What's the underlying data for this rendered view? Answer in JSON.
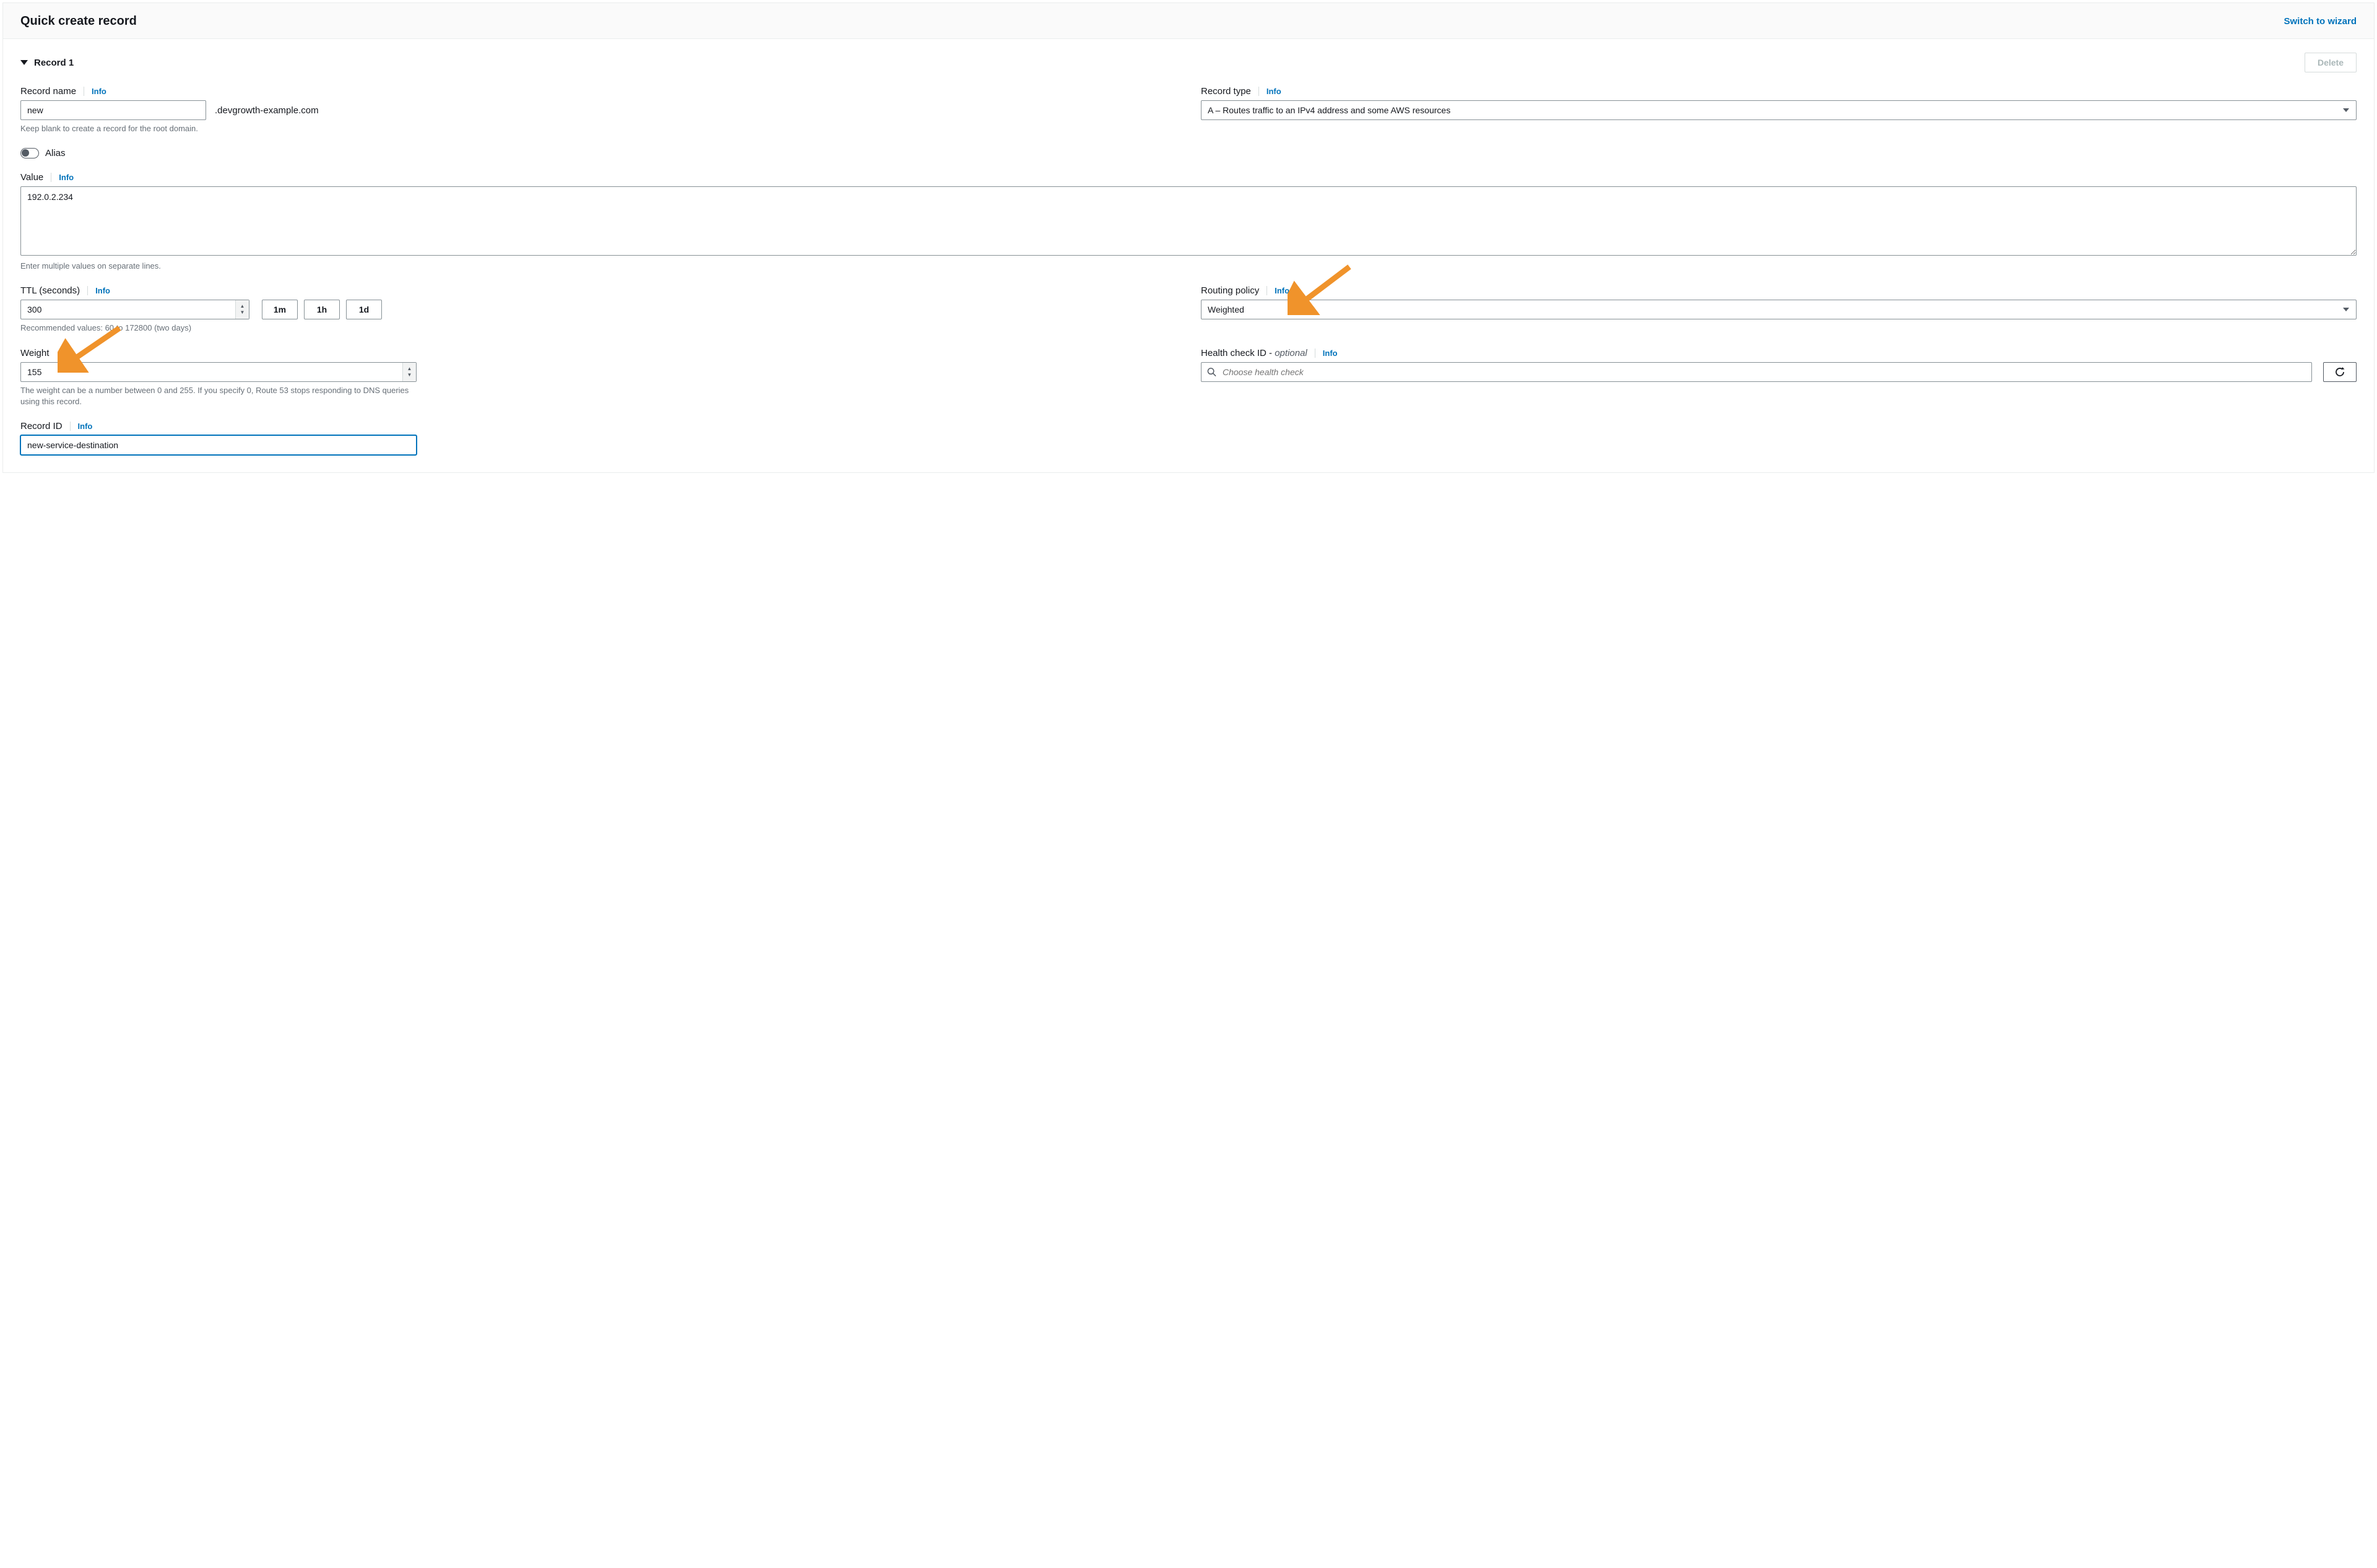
{
  "header": {
    "title": "Quick create record",
    "switch_link": "Switch to wizard"
  },
  "record": {
    "collapse_label": "Record 1",
    "delete_button": "Delete"
  },
  "record_name": {
    "label": "Record name",
    "info": "Info",
    "value": "new",
    "suffix": ".devgrowth-example.com",
    "help": "Keep blank to create a record for the root domain."
  },
  "record_type": {
    "label": "Record type",
    "info": "Info",
    "value": "A – Routes traffic to an IPv4 address and some AWS resources"
  },
  "alias": {
    "label": "Alias",
    "on": false
  },
  "value": {
    "label": "Value",
    "info": "Info",
    "value": "192.0.2.234",
    "help": "Enter multiple values on separate lines."
  },
  "ttl": {
    "label": "TTL (seconds)",
    "info": "Info",
    "value": "300",
    "quick": [
      "1m",
      "1h",
      "1d"
    ],
    "help": "Recommended values: 60 to 172800 (two days)"
  },
  "routing_policy": {
    "label": "Routing policy",
    "info": "Info",
    "value": "Weighted"
  },
  "weight": {
    "label": "Weight",
    "value": "155",
    "help": "The weight can be a number between 0 and 255. If you specify 0, Route 53 stops responding to DNS queries using this record."
  },
  "health_check": {
    "label_main": "Health check ID - ",
    "label_optional": "optional",
    "info": "Info",
    "placeholder": "Choose health check"
  },
  "record_id": {
    "label": "Record ID",
    "info": "Info",
    "value": "new-service-destination"
  },
  "annotation": {
    "arrow_color": "#f0932b"
  }
}
